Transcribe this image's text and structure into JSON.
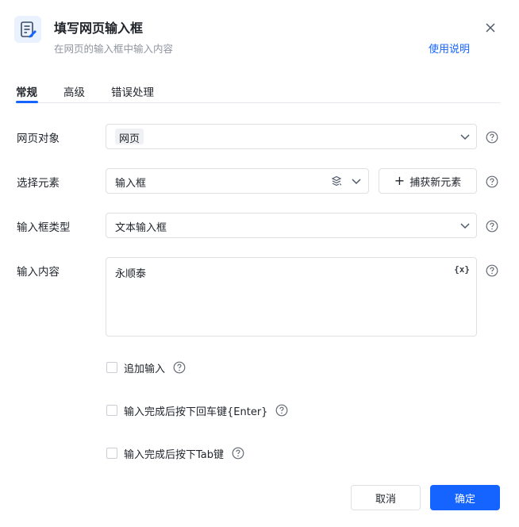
{
  "header": {
    "title": "填写网页输入框",
    "subtitle": "在网页的输入框中输入内容",
    "help_link": "使用说明",
    "icon": "edit-document-icon",
    "close_icon": "close-icon"
  },
  "tabs": [
    {
      "label": "常规",
      "active": true
    },
    {
      "label": "高级",
      "active": false
    },
    {
      "label": "错误处理",
      "active": false
    }
  ],
  "form": {
    "web_object": {
      "label": "网页对象",
      "value": "网页"
    },
    "select_element": {
      "label": "选择元素",
      "value": "输入框",
      "capture_label": "捕获新元素"
    },
    "input_type": {
      "label": "输入框类型",
      "value": "文本输入框"
    },
    "content": {
      "label": "输入内容",
      "value": "永顺泰",
      "var_icon": "{x}"
    }
  },
  "options": [
    {
      "label": "追加输入",
      "checked": false
    },
    {
      "label": "输入完成后按下回车键{Enter}",
      "checked": false
    },
    {
      "label": "输入完成后按下Tab键",
      "checked": false
    }
  ],
  "footer": {
    "cancel_label": "取消",
    "ok_label": "确定"
  },
  "colors": {
    "accent": "#1664ff",
    "border": "#dee0e3",
    "text": "#1f2329",
    "muted": "#8f959e"
  }
}
